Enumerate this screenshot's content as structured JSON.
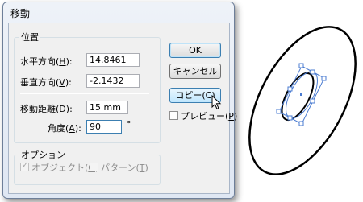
{
  "dialog": {
    "title": "移動"
  },
  "position": {
    "legend": "位置",
    "horizontal": {
      "label_pre": "水平方向(",
      "key": "H",
      "label_post": "):",
      "value": "14.8461"
    },
    "vertical": {
      "label_pre": "垂直方向(",
      "key": "V",
      "label_post": "):",
      "value": "-2.1432"
    },
    "distance": {
      "label_pre": "移動距離(",
      "key": "D",
      "label_post": "):",
      "value": "15 mm"
    },
    "angle": {
      "label_pre": "角度(",
      "key": "A",
      "label_post": "):",
      "value": "90",
      "unit": "°"
    }
  },
  "options": {
    "legend": "オプション",
    "object": {
      "label_pre": "オブジェクト(",
      "key": "O",
      "label_post": ")",
      "checked": true
    },
    "pattern": {
      "label_pre": "パターン(",
      "key": "T",
      "label_post": ")",
      "checked": false
    }
  },
  "buttons": {
    "ok": "OK",
    "cancel": "キャンセル",
    "copy": "コピー(C)"
  },
  "preview": {
    "label_pre": "プレビュー(",
    "key": "P",
    "label_post": ")",
    "checked": false
  }
}
